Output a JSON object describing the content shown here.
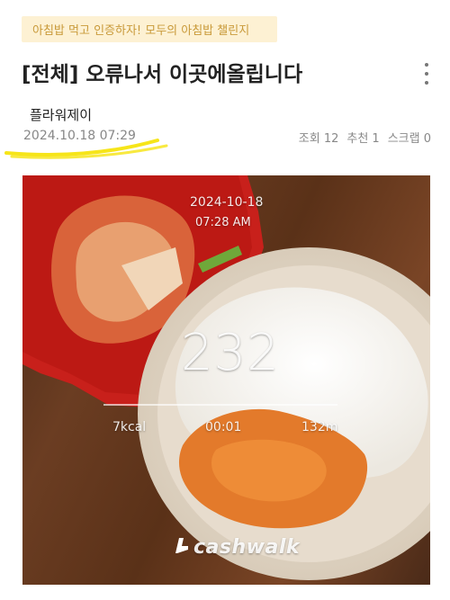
{
  "banner": {
    "text": "아침밥 먹고 인증하자! 모두의 아침밥 챌린지"
  },
  "post": {
    "title": "[전체] 오류나서 이곳에올립니다",
    "author": "플라워제이",
    "datetime": "2024.10.18 07:29",
    "stats": {
      "views": "조회 12",
      "likes": "추천 1",
      "scraps": "스크랩 0"
    }
  },
  "photo_overlay": {
    "date": "2024-10-18",
    "time": "07:28 AM",
    "steps": "232",
    "kcal": "7kcal",
    "duration": "00:01",
    "distance": "132m",
    "brand": "cashwalk"
  },
  "colors": {
    "banner_bg": "#fdf1d3",
    "banner_text": "#c99a3a",
    "highlight": "#f5e200"
  }
}
